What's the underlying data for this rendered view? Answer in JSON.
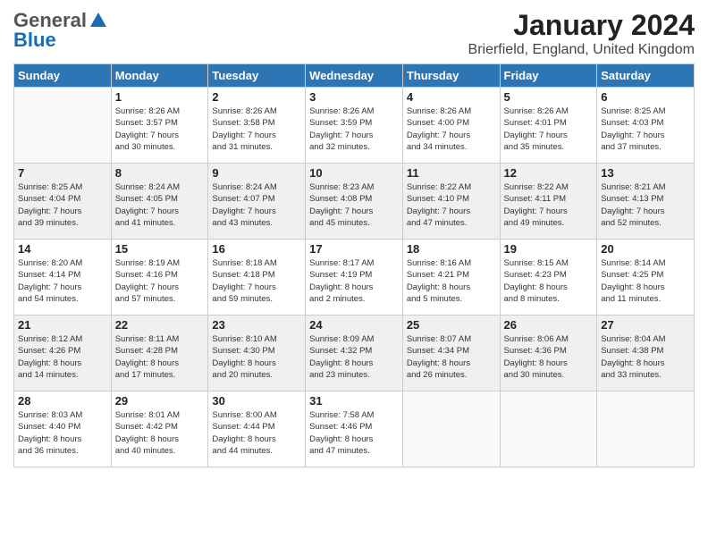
{
  "header": {
    "logo_general": "General",
    "logo_blue": "Blue",
    "month_title": "January 2024",
    "location": "Brierfield, England, United Kingdom"
  },
  "days_of_week": [
    "Sunday",
    "Monday",
    "Tuesday",
    "Wednesday",
    "Thursday",
    "Friday",
    "Saturday"
  ],
  "weeks": [
    [
      {
        "day": "",
        "content": ""
      },
      {
        "day": "1",
        "content": "Sunrise: 8:26 AM\nSunset: 3:57 PM\nDaylight: 7 hours\nand 30 minutes."
      },
      {
        "day": "2",
        "content": "Sunrise: 8:26 AM\nSunset: 3:58 PM\nDaylight: 7 hours\nand 31 minutes."
      },
      {
        "day": "3",
        "content": "Sunrise: 8:26 AM\nSunset: 3:59 PM\nDaylight: 7 hours\nand 32 minutes."
      },
      {
        "day": "4",
        "content": "Sunrise: 8:26 AM\nSunset: 4:00 PM\nDaylight: 7 hours\nand 34 minutes."
      },
      {
        "day": "5",
        "content": "Sunrise: 8:26 AM\nSunset: 4:01 PM\nDaylight: 7 hours\nand 35 minutes."
      },
      {
        "day": "6",
        "content": "Sunrise: 8:25 AM\nSunset: 4:03 PM\nDaylight: 7 hours\nand 37 minutes."
      }
    ],
    [
      {
        "day": "7",
        "content": "Sunrise: 8:25 AM\nSunset: 4:04 PM\nDaylight: 7 hours\nand 39 minutes."
      },
      {
        "day": "8",
        "content": "Sunrise: 8:24 AM\nSunset: 4:05 PM\nDaylight: 7 hours\nand 41 minutes."
      },
      {
        "day": "9",
        "content": "Sunrise: 8:24 AM\nSunset: 4:07 PM\nDaylight: 7 hours\nand 43 minutes."
      },
      {
        "day": "10",
        "content": "Sunrise: 8:23 AM\nSunset: 4:08 PM\nDaylight: 7 hours\nand 45 minutes."
      },
      {
        "day": "11",
        "content": "Sunrise: 8:22 AM\nSunset: 4:10 PM\nDaylight: 7 hours\nand 47 minutes."
      },
      {
        "day": "12",
        "content": "Sunrise: 8:22 AM\nSunset: 4:11 PM\nDaylight: 7 hours\nand 49 minutes."
      },
      {
        "day": "13",
        "content": "Sunrise: 8:21 AM\nSunset: 4:13 PM\nDaylight: 7 hours\nand 52 minutes."
      }
    ],
    [
      {
        "day": "14",
        "content": "Sunrise: 8:20 AM\nSunset: 4:14 PM\nDaylight: 7 hours\nand 54 minutes."
      },
      {
        "day": "15",
        "content": "Sunrise: 8:19 AM\nSunset: 4:16 PM\nDaylight: 7 hours\nand 57 minutes."
      },
      {
        "day": "16",
        "content": "Sunrise: 8:18 AM\nSunset: 4:18 PM\nDaylight: 7 hours\nand 59 minutes."
      },
      {
        "day": "17",
        "content": "Sunrise: 8:17 AM\nSunset: 4:19 PM\nDaylight: 8 hours\nand 2 minutes."
      },
      {
        "day": "18",
        "content": "Sunrise: 8:16 AM\nSunset: 4:21 PM\nDaylight: 8 hours\nand 5 minutes."
      },
      {
        "day": "19",
        "content": "Sunrise: 8:15 AM\nSunset: 4:23 PM\nDaylight: 8 hours\nand 8 minutes."
      },
      {
        "day": "20",
        "content": "Sunrise: 8:14 AM\nSunset: 4:25 PM\nDaylight: 8 hours\nand 11 minutes."
      }
    ],
    [
      {
        "day": "21",
        "content": "Sunrise: 8:12 AM\nSunset: 4:26 PM\nDaylight: 8 hours\nand 14 minutes."
      },
      {
        "day": "22",
        "content": "Sunrise: 8:11 AM\nSunset: 4:28 PM\nDaylight: 8 hours\nand 17 minutes."
      },
      {
        "day": "23",
        "content": "Sunrise: 8:10 AM\nSunset: 4:30 PM\nDaylight: 8 hours\nand 20 minutes."
      },
      {
        "day": "24",
        "content": "Sunrise: 8:09 AM\nSunset: 4:32 PM\nDaylight: 8 hours\nand 23 minutes."
      },
      {
        "day": "25",
        "content": "Sunrise: 8:07 AM\nSunset: 4:34 PM\nDaylight: 8 hours\nand 26 minutes."
      },
      {
        "day": "26",
        "content": "Sunrise: 8:06 AM\nSunset: 4:36 PM\nDaylight: 8 hours\nand 30 minutes."
      },
      {
        "day": "27",
        "content": "Sunrise: 8:04 AM\nSunset: 4:38 PM\nDaylight: 8 hours\nand 33 minutes."
      }
    ],
    [
      {
        "day": "28",
        "content": "Sunrise: 8:03 AM\nSunset: 4:40 PM\nDaylight: 8 hours\nand 36 minutes."
      },
      {
        "day": "29",
        "content": "Sunrise: 8:01 AM\nSunset: 4:42 PM\nDaylight: 8 hours\nand 40 minutes."
      },
      {
        "day": "30",
        "content": "Sunrise: 8:00 AM\nSunset: 4:44 PM\nDaylight: 8 hours\nand 44 minutes."
      },
      {
        "day": "31",
        "content": "Sunrise: 7:58 AM\nSunset: 4:46 PM\nDaylight: 8 hours\nand 47 minutes."
      },
      {
        "day": "",
        "content": ""
      },
      {
        "day": "",
        "content": ""
      },
      {
        "day": "",
        "content": ""
      }
    ]
  ]
}
